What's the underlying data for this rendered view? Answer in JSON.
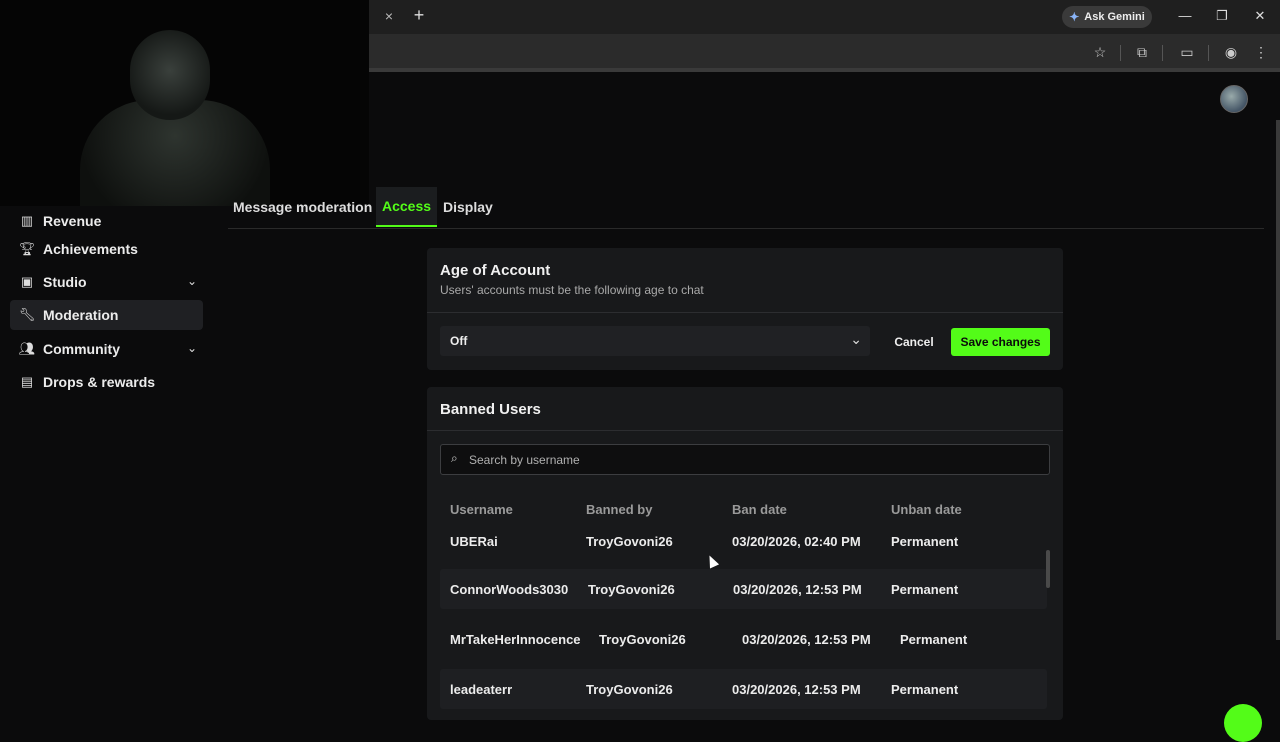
{
  "browser": {
    "tab_close": "×",
    "new_tab": "+",
    "ask_gemini": "Ask Gemini",
    "window": {
      "minimize": "—",
      "restore": "❐",
      "close": "✕"
    },
    "toolbar_icons": [
      "star-icon",
      "extensions-icon",
      "cast-icon",
      "profile-icon",
      "menu-icon"
    ]
  },
  "sidebar": {
    "items": [
      {
        "label": "Revenue",
        "icon": "▥",
        "chevron": ""
      },
      {
        "label": "Achievements",
        "icon": "🏆︎",
        "chevron": ""
      },
      {
        "label": "Studio",
        "icon": "▣",
        "chevron": "⌄"
      },
      {
        "label": "Moderation",
        "icon": "🔧︎",
        "chevron": ""
      },
      {
        "label": "Community",
        "icon": "👥︎",
        "chevron": "⌄"
      },
      {
        "label": "Drops & rewards",
        "icon": "▤",
        "chevron": ""
      }
    ],
    "active_index": 3
  },
  "tabs": [
    {
      "label": "Message moderation"
    },
    {
      "label": "Access"
    },
    {
      "label": "Display"
    }
  ],
  "age_card": {
    "title": "Age of Account",
    "subtitle": "Users' accounts must be the following age to chat",
    "select_value": "Off",
    "cancel": "Cancel",
    "save": "Save changes"
  },
  "banned_card": {
    "title": "Banned Users",
    "search_placeholder": "Search by username",
    "columns": [
      "Username",
      "Banned by",
      "Ban date",
      "Unban date"
    ],
    "rows": [
      [
        "UBERai",
        "TroyGovoni26",
        "03/20/2026, 02:40 PM",
        "Permanent"
      ],
      [
        "ConnorWoods3030",
        "TroyGovoni26",
        "03/20/2026, 12:53 PM",
        "Permanent"
      ],
      [
        "MrTakeHerInnocence",
        "TroyGovoni26",
        "03/20/2026, 12:53 PM",
        "Permanent"
      ],
      [
        "leadeaterr",
        "TroyGovoni26",
        "03/20/2026, 12:53 PM",
        "Permanent"
      ]
    ]
  },
  "colors": {
    "accent": "#53fc18",
    "background": "#0b0b0c",
    "card": "#18191b"
  }
}
